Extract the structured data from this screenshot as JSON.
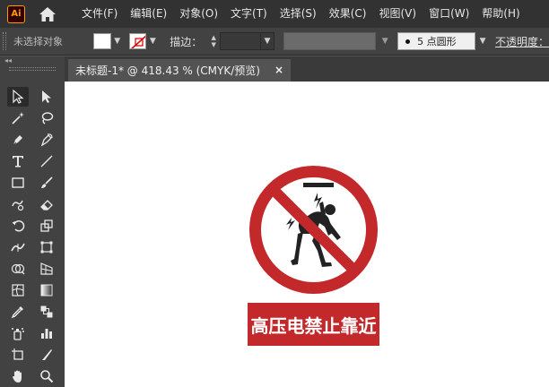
{
  "app": {
    "logo_text": "Ai"
  },
  "menu": {
    "items": [
      {
        "label": "文件(F)"
      },
      {
        "label": "编辑(E)"
      },
      {
        "label": "对象(O)"
      },
      {
        "label": "文字(T)"
      },
      {
        "label": "选择(S)"
      },
      {
        "label": "效果(C)"
      },
      {
        "label": "视图(V)"
      },
      {
        "label": "窗口(W)"
      },
      {
        "label": "帮助(H)"
      }
    ]
  },
  "control_bar": {
    "selection_status": "未选择对象",
    "stroke_label": "描边：",
    "stroke_weight": "",
    "brush_label": "5 点圆形",
    "opacity_label": "不透明度："
  },
  "toolbar_head": {
    "collapse_glyph": "◂◂"
  },
  "document": {
    "tab_label": "未标题-1* @ 418.43 % (CMYK/预览)",
    "close_glyph": "×"
  },
  "artwork": {
    "sign_text": "高压电禁止靠近",
    "sign_red": "#c3292b",
    "figure_color": "#222222"
  },
  "colors": {
    "menubar_bg": "#323232",
    "panel_bg": "#424242",
    "workspace_bg": "#535353",
    "ai_brand": "#ff9a00"
  },
  "tools": [
    "selection-tool",
    "direct-selection-tool",
    "magic-wand-tool",
    "lasso-tool",
    "pen-tool",
    "curvature-tool",
    "type-tool",
    "line-segment-tool",
    "rectangle-tool",
    "paintbrush-tool",
    "shaper-tool",
    "eraser-tool",
    "rotate-tool",
    "scale-tool",
    "width-tool",
    "free-transform-tool",
    "shape-builder-tool",
    "perspective-grid-tool",
    "mesh-tool",
    "gradient-tool",
    "eyedropper-tool",
    "blend-tool",
    "symbol-sprayer-tool",
    "column-graph-tool",
    "artboard-tool",
    "slice-tool",
    "hand-tool",
    "zoom-tool"
  ]
}
